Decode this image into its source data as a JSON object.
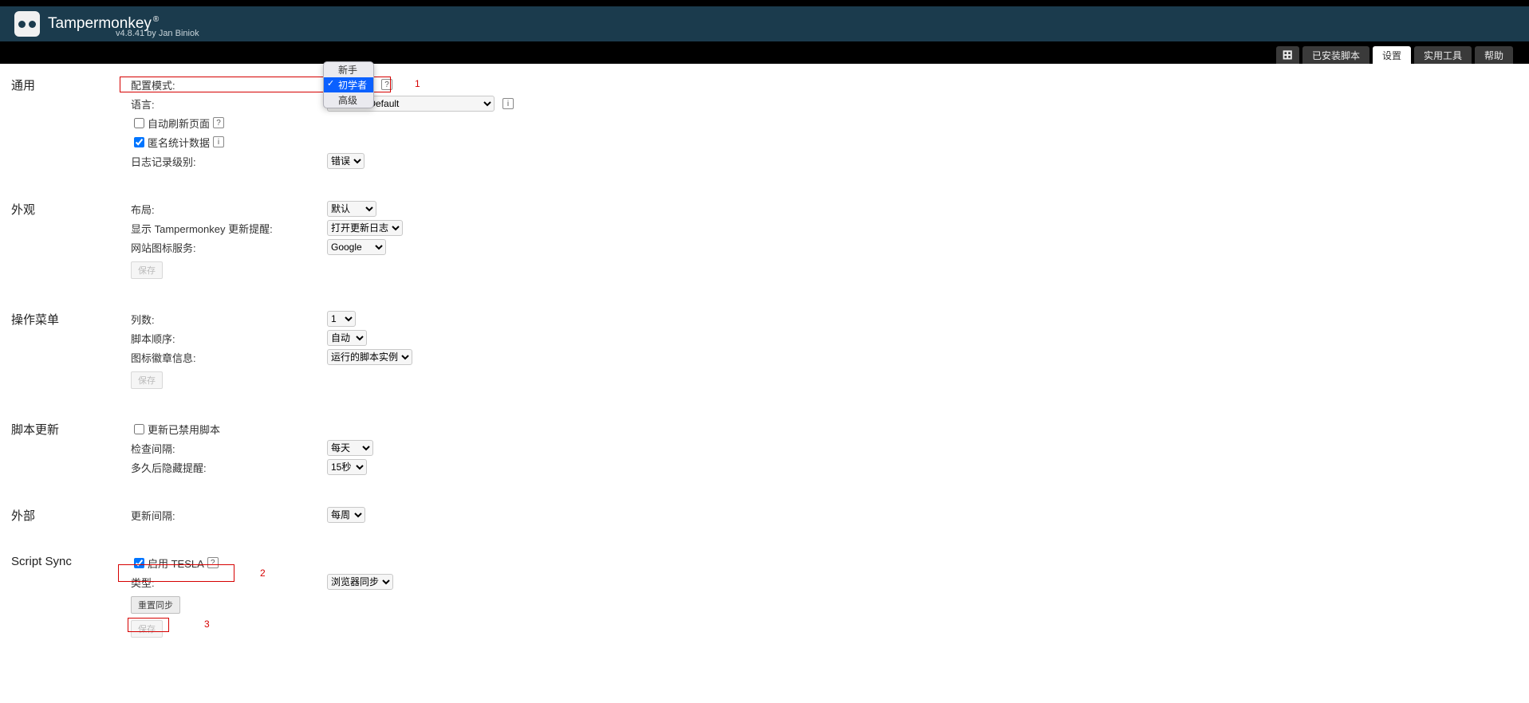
{
  "app": {
    "title": "Tampermonkey",
    "reg": "®",
    "subtitle": "v4.8.41 by Jan Biniok"
  },
  "tabs": {
    "add": "⊞",
    "installed": "已安装脚本",
    "settings": "设置",
    "tools": "实用工具",
    "help": "帮助"
  },
  "dropdown": {
    "opt0": "新手",
    "opt1": "初学者",
    "opt2": "高级"
  },
  "annotations": {
    "a1": "1",
    "a2": "2",
    "a3": "3"
  },
  "sec_general": {
    "title": "通用",
    "config_mode": "配置模式:",
    "config_help": "?",
    "language": "语言:",
    "language_value": "Browser Default",
    "auto_refresh": "自动刷新页面",
    "anon_stats": "匿名统计数据",
    "log_level": "日志记录级别:",
    "log_level_value": "错误"
  },
  "sec_appearance": {
    "title": "外观",
    "layout": "布局:",
    "layout_value": "默认",
    "show_update": "显示 Tampermonkey 更新提醒:",
    "show_update_value": "打开更新日志",
    "favicon": "网站图标服务:",
    "favicon_value": "Google",
    "save": "保存"
  },
  "sec_menu": {
    "title": "操作菜单",
    "cols": "列数:",
    "cols_value": "1",
    "script_order": "脚本顺序:",
    "script_order_value": "自动",
    "badge": "图标徽章信息:",
    "badge_value": "运行的脚本实例",
    "save": "保存"
  },
  "sec_update": {
    "title": "脚本更新",
    "update_disabled": "更新已禁用脚本",
    "check_interval": "检查间隔:",
    "check_interval_value": "每天",
    "hide_after": "多久后隐藏提醒:",
    "hide_after_value": "15秒"
  },
  "sec_external": {
    "title": "外部",
    "update_interval": "更新间隔:",
    "update_interval_value": "每周"
  },
  "sec_sync": {
    "title": "Script Sync",
    "enable_tesla": "启用 TESLA",
    "type": "类型:",
    "type_value": "浏览器同步",
    "reset": "重置同步",
    "save": "保存"
  }
}
